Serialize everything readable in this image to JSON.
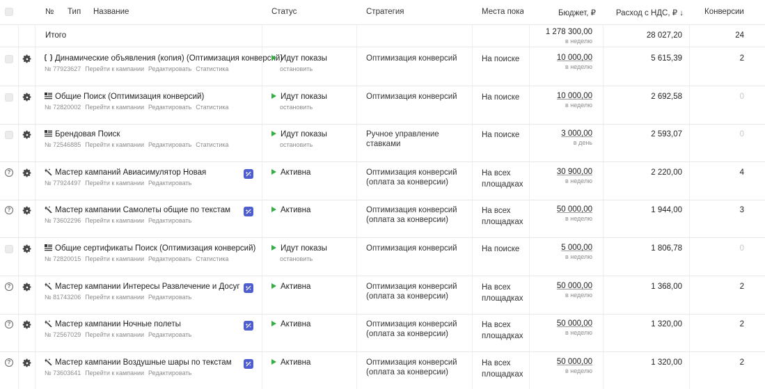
{
  "header": {
    "num": "№",
    "type": "Тип",
    "name": "Название",
    "status": "Статус",
    "strategy": "Стратегия",
    "places": "Места показ",
    "budget": "Бюджет, ₽",
    "spend": "Расход с НДС, ₽ ↓",
    "conversions": "Конверсии"
  },
  "total": {
    "label": "Итого",
    "budget": "1 278 300,00",
    "budget_period": "в неделю",
    "spend": "28 027,20",
    "conversions": "24"
  },
  "links": {
    "goto": "Перейти к кампании",
    "edit": "Редактировать",
    "stats": "Статистика",
    "stop": "остановить"
  },
  "rows": [
    {
      "row_icon": "checkbox",
      "type_icon": "dynamic-ads-icon",
      "name": "Динамические объявления (копия) (Оптимизация конверсий)",
      "id": "№ 77923627",
      "has_stats": true,
      "badge": false,
      "status": "Идут показы",
      "has_stop": true,
      "strategy": "Оптимизация конверсий",
      "places": "На поиске",
      "budget": "10 000,00",
      "period": "в неделю",
      "spend": "5 615,39",
      "conversions": "2"
    },
    {
      "row_icon": "checkbox",
      "type_icon": "text-ads-icon",
      "name": "Общие Поиск (Оптимизация конверсий)",
      "id": "№ 72820002",
      "has_stats": true,
      "badge": false,
      "status": "Идут показы",
      "has_stop": true,
      "strategy": "Оптимизация конверсий",
      "places": "На поиске",
      "budget": "10 000,00",
      "period": "в неделю",
      "spend": "2 692,58",
      "conversions": "0"
    },
    {
      "row_icon": "checkbox",
      "type_icon": "text-ads-icon",
      "name": "Брендовая Поиск",
      "id": "№ 72546885",
      "has_stats": true,
      "badge": false,
      "status": "Идут показы",
      "has_stop": true,
      "strategy": "Ручное управление ставками",
      "places": "На поиске",
      "budget": "3 000,00",
      "period": "в день",
      "spend": "2 593,07",
      "conversions": "0"
    },
    {
      "row_icon": "help",
      "type_icon": "master-campaign-icon",
      "name": "Мастер кампаний Авиасимулятор Новая",
      "id": "№ 77924497",
      "has_stats": false,
      "badge": true,
      "status": "Активна",
      "has_stop": false,
      "strategy": "Оптимизация конверсий (оплата за конверсии)",
      "places": "На всех площадках",
      "budget": "30 900,00",
      "period": "в неделю",
      "spend": "2 220,00",
      "conversions": "4"
    },
    {
      "row_icon": "help",
      "type_icon": "master-campaign-icon",
      "name": "Мастер кампании Самолеты общие по текстам",
      "id": "№ 73602296",
      "has_stats": false,
      "badge": true,
      "status": "Активна",
      "has_stop": false,
      "strategy": "Оптимизация конверсий (оплата за конверсии)",
      "places": "На всех площадках",
      "budget": "50 000,00",
      "period": "в неделю",
      "spend": "1 944,00",
      "conversions": "3"
    },
    {
      "row_icon": "checkbox",
      "type_icon": "text-ads-icon",
      "name": "Общие сертификаты Поиск (Оптимизация конверсий)",
      "id": "№ 72820015",
      "has_stats": true,
      "badge": false,
      "status": "Идут показы",
      "has_stop": true,
      "strategy": "Оптимизация конверсий",
      "places": "На поиске",
      "budget": "5 000,00",
      "period": "в неделю",
      "spend": "1 806,78",
      "conversions": "0"
    },
    {
      "row_icon": "help",
      "type_icon": "master-campaign-icon",
      "name": "Мастер кампании Интересы Развлечение и Досуг",
      "id": "№ 81743206",
      "has_stats": false,
      "badge": true,
      "status": "Активна",
      "has_stop": false,
      "strategy": "Оптимизация конверсий (оплата за конверсии)",
      "places": "На всех площадках",
      "budget": "50 000,00",
      "period": "в неделю",
      "spend": "1 368,00",
      "conversions": "2"
    },
    {
      "row_icon": "help",
      "type_icon": "master-campaign-icon",
      "name": "Мастер кампании Ночные полеты",
      "id": "№ 72567029",
      "has_stats": false,
      "badge": true,
      "status": "Активна",
      "has_stop": false,
      "strategy": "Оптимизация конверсий (оплата за конверсии)",
      "places": "На всех площадках",
      "budget": "50 000,00",
      "period": "в неделю",
      "spend": "1 320,00",
      "conversions": "2"
    },
    {
      "row_icon": "help",
      "type_icon": "master-campaign-icon",
      "name": "Мастер кампании Воздушные шары по текстам",
      "id": "№ 73603641",
      "has_stats": false,
      "badge": true,
      "status": "Активна",
      "has_stop": false,
      "strategy": "Оптимизация конверсий (оплата за конверсии)",
      "places": "На всех площадках",
      "budget": "50 000,00",
      "period": "в неделю",
      "spend": "1 320,00",
      "conversions": "2"
    }
  ],
  "colors": {
    "active_green": "#3ba84a",
    "badge_blue": "#4f5ecf",
    "muted_text": "#8c8c8c"
  }
}
